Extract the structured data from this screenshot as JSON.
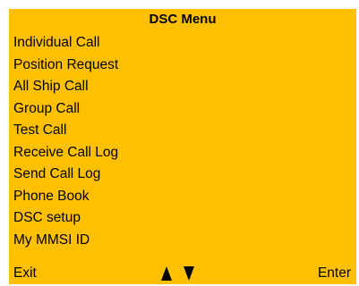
{
  "title": "DSC Menu",
  "menu_items": [
    {
      "label": "Individual Call"
    },
    {
      "label": "Position Request"
    },
    {
      "label": "All Ship Call"
    },
    {
      "label": "Group Call"
    },
    {
      "label": "Test Call"
    },
    {
      "label": "Receive Call Log"
    },
    {
      "label": "Send Call Log"
    },
    {
      "label": "Phone Book"
    },
    {
      "label": "DSC setup"
    },
    {
      "label": "My MMSI ID"
    }
  ],
  "footer": {
    "left_label": "Exit",
    "right_label": "Enter",
    "up_icon": "triangle-up-icon",
    "down_icon": "triangle-down-icon"
  },
  "colors": {
    "screen_background": "#ffc000",
    "text": "#000000"
  }
}
